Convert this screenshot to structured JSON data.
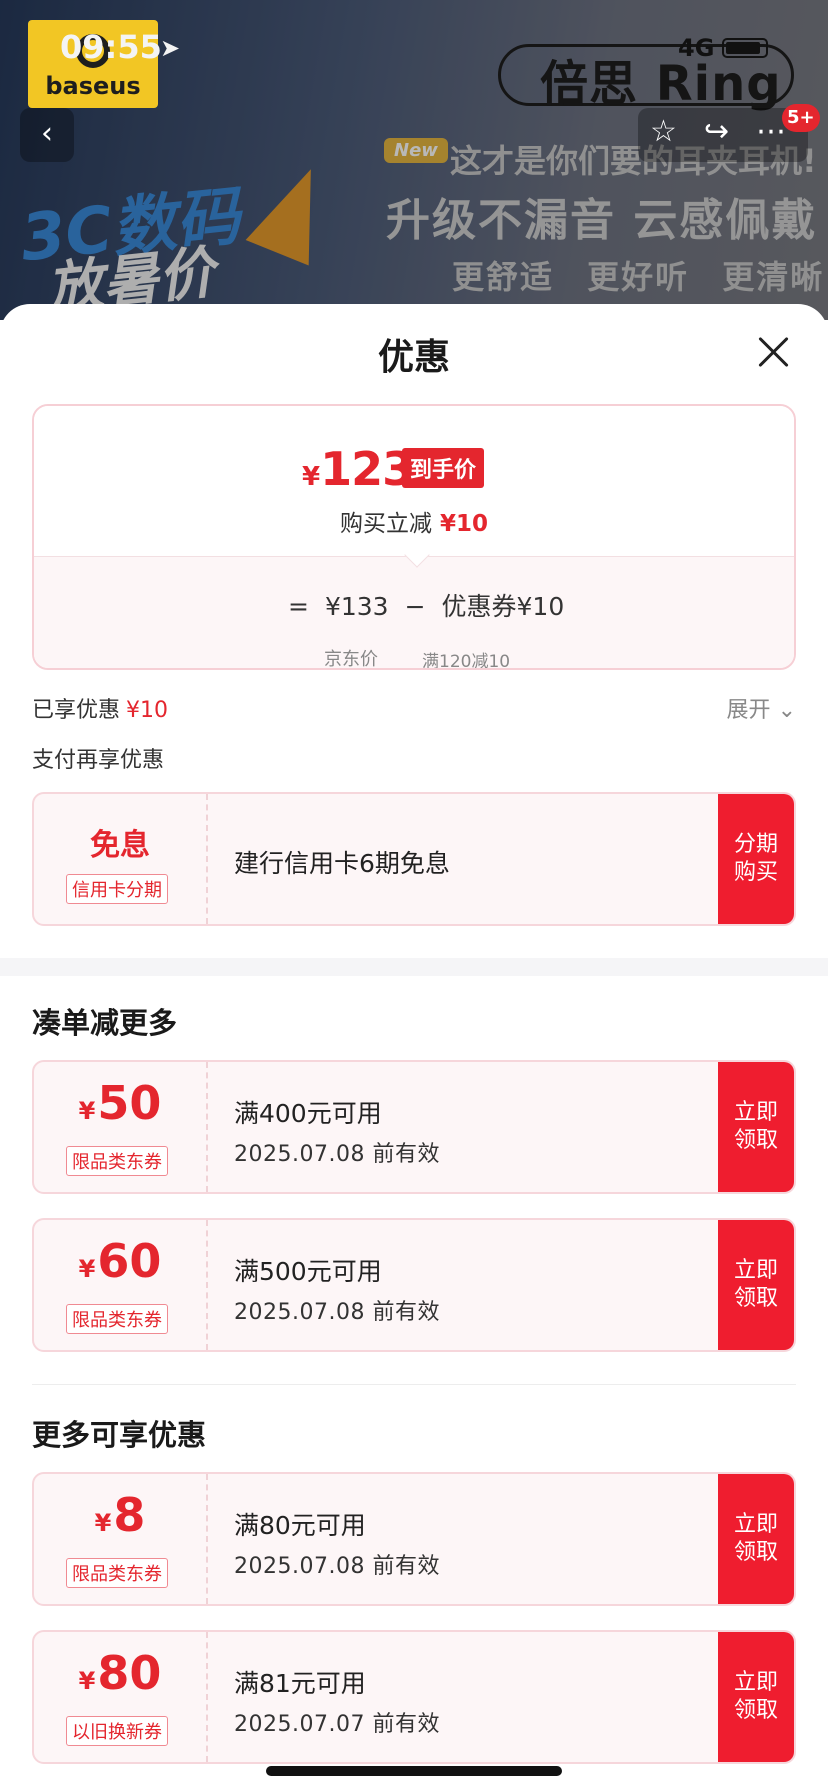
{
  "status_bar": {
    "time": "09:55",
    "network": "4G"
  },
  "banner": {
    "logo_text": "baseus",
    "brand_title": "倍思 Ring",
    "new_tag": "New",
    "headline1": "这才是你们要的耳夹耳机!",
    "headline2": "升级不漏音 云感佩戴",
    "headline3": "更舒适 更好听 更清晰",
    "campaign1": "3C数码",
    "campaign2": "放暑价",
    "cart_badge": "5+"
  },
  "sheet": {
    "title": "优惠",
    "summary": {
      "final_currency": "¥",
      "final_price": "123",
      "final_tag": "到手价",
      "instant_label": "购买立减",
      "instant_amount": "¥10",
      "calc_eq": "=",
      "calc_price": "¥133",
      "calc_minus": "−",
      "calc_coupon": "优惠券¥10",
      "calc_price_label": "京东价",
      "calc_coupon_label": "满120减10"
    },
    "enjoyed_label": "已享优惠",
    "enjoyed_amount": "¥10",
    "expand_label": "展开",
    "pay_section_title": "支付再享优惠",
    "pay_offer": {
      "title": "免息",
      "tag": "信用卡分期",
      "desc": "建行信用卡6期免息",
      "cta": "分期购买"
    },
    "section_more_title": "凑单减更多",
    "section_extra_title": "更多可享优惠",
    "coupons_more": [
      {
        "currency": "¥",
        "amount": "50",
        "tag": "限品类东券",
        "condition": "满400元可用",
        "valid": "2025.07.08 前有效",
        "cta": "立即领取"
      },
      {
        "currency": "¥",
        "amount": "60",
        "tag": "限品类东券",
        "condition": "满500元可用",
        "valid": "2025.07.08 前有效",
        "cta": "立即领取"
      }
    ],
    "coupons_extra": [
      {
        "currency": "¥",
        "amount": "8",
        "tag": "限品类东券",
        "condition": "满80元可用",
        "valid": "2025.07.08 前有效",
        "cta": "立即领取"
      },
      {
        "currency": "¥",
        "amount": "80",
        "tag": "以旧换新券",
        "condition": "满81元可用",
        "valid": "2025.07.07 前有效",
        "cta": "立即领取"
      }
    ]
  },
  "colors": {
    "accent_red": "#e4262e",
    "cta_red": "#ef1d2f",
    "card_border": "#f6d6db"
  }
}
